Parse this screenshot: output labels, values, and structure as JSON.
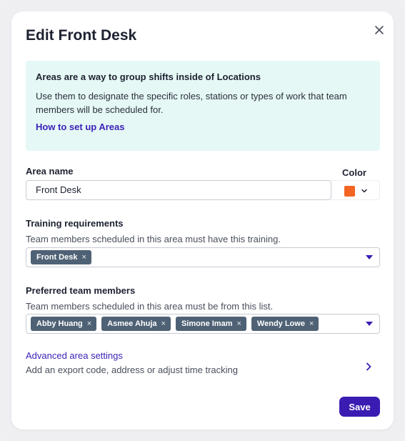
{
  "dialog": {
    "title": "Edit Front Desk",
    "close_icon": "close-icon"
  },
  "info": {
    "title": "Areas are a way to group shifts inside of Locations",
    "body": "Use them to designate the specific roles, stations or types of work that team members will be scheduled for.",
    "link": "How to set up Areas"
  },
  "area_name": {
    "label": "Area name",
    "value": "Front Desk"
  },
  "color": {
    "label": "Color",
    "value": "#f26522",
    "icon": "chevron-down-icon"
  },
  "training": {
    "label": "Training requirements",
    "help": "Team members scheduled in this area must have this training.",
    "selected": [
      {
        "label": "Front Desk",
        "remove": "×"
      }
    ],
    "icon": "caret-down-icon"
  },
  "preferred": {
    "label": "Preferred team members",
    "help": "Team members scheduled in this area must be from this list.",
    "selected": [
      {
        "label": "Abby Huang",
        "remove": "×"
      },
      {
        "label": "Asmee Ahuja",
        "remove": "×"
      },
      {
        "label": "Simone Imam",
        "remove": "×"
      },
      {
        "label": "Wendy Lowe",
        "remove": "×"
      }
    ],
    "icon": "caret-down-icon"
  },
  "advanced": {
    "title": "Advanced area settings",
    "subtitle": "Add an export code, address or adjust time tracking",
    "icon": "chevron-right-icon"
  },
  "footer": {
    "save_label": "Save"
  },
  "colors": {
    "accent": "#3b1cb2",
    "info_bg": "#e5f8f5",
    "chip_bg": "#4f6275"
  }
}
